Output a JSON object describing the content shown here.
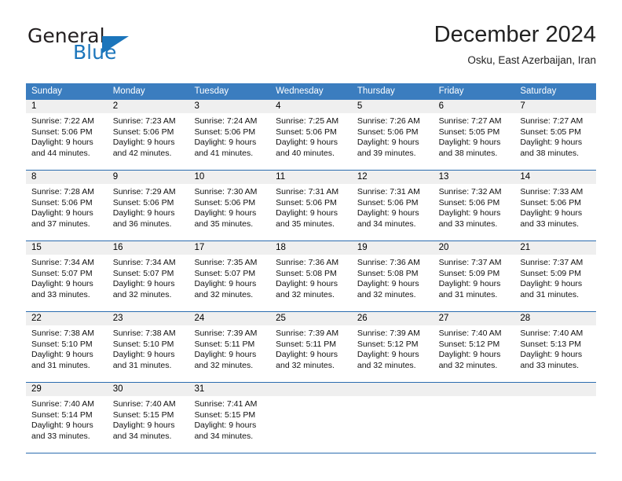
{
  "brand": {
    "name_part1": "General",
    "name_part2": "Blue",
    "triangle_color": "#1b75bb"
  },
  "header": {
    "title": "December 2024",
    "subtitle": "Osku, East Azerbaijan, Iran"
  },
  "colors": {
    "header_row": "#3b7dbf",
    "day_number_band": "#efefef",
    "week_divider": "#2b6caf",
    "brand_blue": "#1b75bb"
  },
  "weekdays": [
    "Sunday",
    "Monday",
    "Tuesday",
    "Wednesday",
    "Thursday",
    "Friday",
    "Saturday"
  ],
  "weeks": [
    [
      {
        "day": "1",
        "sunrise": "Sunrise: 7:22 AM",
        "sunset": "Sunset: 5:06 PM",
        "daylight1": "Daylight: 9 hours",
        "daylight2": "and 44 minutes."
      },
      {
        "day": "2",
        "sunrise": "Sunrise: 7:23 AM",
        "sunset": "Sunset: 5:06 PM",
        "daylight1": "Daylight: 9 hours",
        "daylight2": "and 42 minutes."
      },
      {
        "day": "3",
        "sunrise": "Sunrise: 7:24 AM",
        "sunset": "Sunset: 5:06 PM",
        "daylight1": "Daylight: 9 hours",
        "daylight2": "and 41 minutes."
      },
      {
        "day": "4",
        "sunrise": "Sunrise: 7:25 AM",
        "sunset": "Sunset: 5:06 PM",
        "daylight1": "Daylight: 9 hours",
        "daylight2": "and 40 minutes."
      },
      {
        "day": "5",
        "sunrise": "Sunrise: 7:26 AM",
        "sunset": "Sunset: 5:06 PM",
        "daylight1": "Daylight: 9 hours",
        "daylight2": "and 39 minutes."
      },
      {
        "day": "6",
        "sunrise": "Sunrise: 7:27 AM",
        "sunset": "Sunset: 5:05 PM",
        "daylight1": "Daylight: 9 hours",
        "daylight2": "and 38 minutes."
      },
      {
        "day": "7",
        "sunrise": "Sunrise: 7:27 AM",
        "sunset": "Sunset: 5:05 PM",
        "daylight1": "Daylight: 9 hours",
        "daylight2": "and 38 minutes."
      }
    ],
    [
      {
        "day": "8",
        "sunrise": "Sunrise: 7:28 AM",
        "sunset": "Sunset: 5:06 PM",
        "daylight1": "Daylight: 9 hours",
        "daylight2": "and 37 minutes."
      },
      {
        "day": "9",
        "sunrise": "Sunrise: 7:29 AM",
        "sunset": "Sunset: 5:06 PM",
        "daylight1": "Daylight: 9 hours",
        "daylight2": "and 36 minutes."
      },
      {
        "day": "10",
        "sunrise": "Sunrise: 7:30 AM",
        "sunset": "Sunset: 5:06 PM",
        "daylight1": "Daylight: 9 hours",
        "daylight2": "and 35 minutes."
      },
      {
        "day": "11",
        "sunrise": "Sunrise: 7:31 AM",
        "sunset": "Sunset: 5:06 PM",
        "daylight1": "Daylight: 9 hours",
        "daylight2": "and 35 minutes."
      },
      {
        "day": "12",
        "sunrise": "Sunrise: 7:31 AM",
        "sunset": "Sunset: 5:06 PM",
        "daylight1": "Daylight: 9 hours",
        "daylight2": "and 34 minutes."
      },
      {
        "day": "13",
        "sunrise": "Sunrise: 7:32 AM",
        "sunset": "Sunset: 5:06 PM",
        "daylight1": "Daylight: 9 hours",
        "daylight2": "and 33 minutes."
      },
      {
        "day": "14",
        "sunrise": "Sunrise: 7:33 AM",
        "sunset": "Sunset: 5:06 PM",
        "daylight1": "Daylight: 9 hours",
        "daylight2": "and 33 minutes."
      }
    ],
    [
      {
        "day": "15",
        "sunrise": "Sunrise: 7:34 AM",
        "sunset": "Sunset: 5:07 PM",
        "daylight1": "Daylight: 9 hours",
        "daylight2": "and 33 minutes."
      },
      {
        "day": "16",
        "sunrise": "Sunrise: 7:34 AM",
        "sunset": "Sunset: 5:07 PM",
        "daylight1": "Daylight: 9 hours",
        "daylight2": "and 32 minutes."
      },
      {
        "day": "17",
        "sunrise": "Sunrise: 7:35 AM",
        "sunset": "Sunset: 5:07 PM",
        "daylight1": "Daylight: 9 hours",
        "daylight2": "and 32 minutes."
      },
      {
        "day": "18",
        "sunrise": "Sunrise: 7:36 AM",
        "sunset": "Sunset: 5:08 PM",
        "daylight1": "Daylight: 9 hours",
        "daylight2": "and 32 minutes."
      },
      {
        "day": "19",
        "sunrise": "Sunrise: 7:36 AM",
        "sunset": "Sunset: 5:08 PM",
        "daylight1": "Daylight: 9 hours",
        "daylight2": "and 32 minutes."
      },
      {
        "day": "20",
        "sunrise": "Sunrise: 7:37 AM",
        "sunset": "Sunset: 5:09 PM",
        "daylight1": "Daylight: 9 hours",
        "daylight2": "and 31 minutes."
      },
      {
        "day": "21",
        "sunrise": "Sunrise: 7:37 AM",
        "sunset": "Sunset: 5:09 PM",
        "daylight1": "Daylight: 9 hours",
        "daylight2": "and 31 minutes."
      }
    ],
    [
      {
        "day": "22",
        "sunrise": "Sunrise: 7:38 AM",
        "sunset": "Sunset: 5:10 PM",
        "daylight1": "Daylight: 9 hours",
        "daylight2": "and 31 minutes."
      },
      {
        "day": "23",
        "sunrise": "Sunrise: 7:38 AM",
        "sunset": "Sunset: 5:10 PM",
        "daylight1": "Daylight: 9 hours",
        "daylight2": "and 31 minutes."
      },
      {
        "day": "24",
        "sunrise": "Sunrise: 7:39 AM",
        "sunset": "Sunset: 5:11 PM",
        "daylight1": "Daylight: 9 hours",
        "daylight2": "and 32 minutes."
      },
      {
        "day": "25",
        "sunrise": "Sunrise: 7:39 AM",
        "sunset": "Sunset: 5:11 PM",
        "daylight1": "Daylight: 9 hours",
        "daylight2": "and 32 minutes."
      },
      {
        "day": "26",
        "sunrise": "Sunrise: 7:39 AM",
        "sunset": "Sunset: 5:12 PM",
        "daylight1": "Daylight: 9 hours",
        "daylight2": "and 32 minutes."
      },
      {
        "day": "27",
        "sunrise": "Sunrise: 7:40 AM",
        "sunset": "Sunset: 5:12 PM",
        "daylight1": "Daylight: 9 hours",
        "daylight2": "and 32 minutes."
      },
      {
        "day": "28",
        "sunrise": "Sunrise: 7:40 AM",
        "sunset": "Sunset: 5:13 PM",
        "daylight1": "Daylight: 9 hours",
        "daylight2": "and 33 minutes."
      }
    ],
    [
      {
        "day": "29",
        "sunrise": "Sunrise: 7:40 AM",
        "sunset": "Sunset: 5:14 PM",
        "daylight1": "Daylight: 9 hours",
        "daylight2": "and 33 minutes."
      },
      {
        "day": "30",
        "sunrise": "Sunrise: 7:40 AM",
        "sunset": "Sunset: 5:15 PM",
        "daylight1": "Daylight: 9 hours",
        "daylight2": "and 34 minutes."
      },
      {
        "day": "31",
        "sunrise": "Sunrise: 7:41 AM",
        "sunset": "Sunset: 5:15 PM",
        "daylight1": "Daylight: 9 hours",
        "daylight2": "and 34 minutes."
      },
      {
        "day": "",
        "sunrise": "",
        "sunset": "",
        "daylight1": "",
        "daylight2": ""
      },
      {
        "day": "",
        "sunrise": "",
        "sunset": "",
        "daylight1": "",
        "daylight2": ""
      },
      {
        "day": "",
        "sunrise": "",
        "sunset": "",
        "daylight1": "",
        "daylight2": ""
      },
      {
        "day": "",
        "sunrise": "",
        "sunset": "",
        "daylight1": "",
        "daylight2": ""
      }
    ]
  ]
}
